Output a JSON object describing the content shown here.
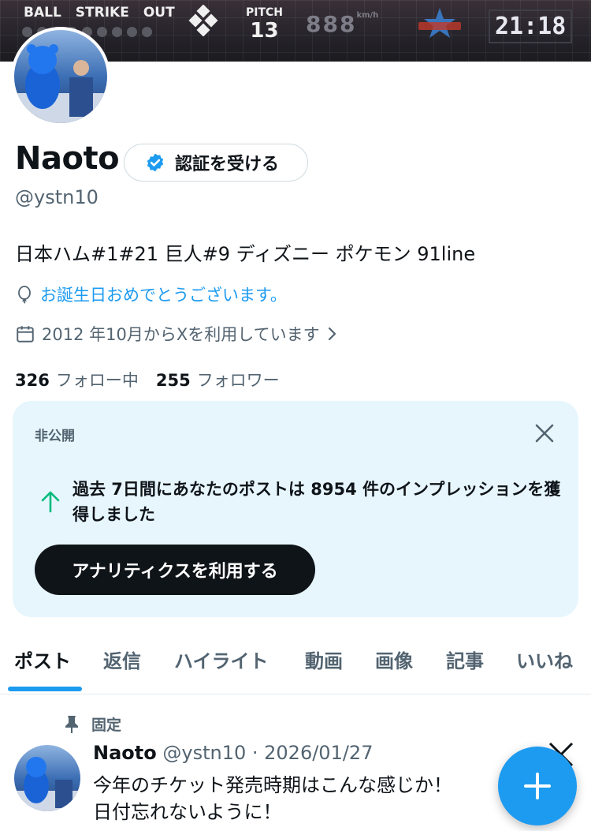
{
  "banner": {
    "ball_label": "BALL",
    "strike_label": "STRIKE",
    "out_label": "OUT",
    "pitch_label": "PITCH",
    "pitch_count": "13",
    "speed_digits": "888",
    "speed_unit": "km/h",
    "clock": "21:18"
  },
  "profile": {
    "name": "Naoto",
    "verify_label": "認証を受ける",
    "handle": "@ystn10",
    "bio": "日本ハム#1#21 巨人#9 ディズニー ポケモン 91line",
    "birthday_text": "お誕生日おめでとうございます。",
    "joined_text": "2012 年10月からXを利用しています",
    "following_count": "326",
    "following_label": "フォロー中",
    "followers_count": "255",
    "followers_label": "フォロワー"
  },
  "analytics_card": {
    "private_label": "非公開",
    "message": "過去 7日間にあなたのポストは 8954 件のインプレッションを獲得しました",
    "cta_label": "アナリティクスを利用する"
  },
  "tabs": [
    {
      "label": "ポスト",
      "active": true
    },
    {
      "label": "返信",
      "active": false
    },
    {
      "label": "ハイライト",
      "active": false
    },
    {
      "label": "動画",
      "active": false
    },
    {
      "label": "画像",
      "active": false
    },
    {
      "label": "記事",
      "active": false
    },
    {
      "label": "いいね",
      "active": false
    }
  ],
  "pinned_post": {
    "pinned_label": "固定",
    "author_name": "Naoto",
    "meta": "@ystn10 · 2026/01/27",
    "text_line1": "今年のチケット発売時期はこんな感じか！",
    "text_line2": "日付忘れないように！"
  },
  "colors": {
    "accent": "#1d9bf0",
    "card_bg": "#e7f6fd",
    "text_primary": "#0f1419",
    "text_secondary": "#536471",
    "up_arrow": "#00ba7c"
  }
}
